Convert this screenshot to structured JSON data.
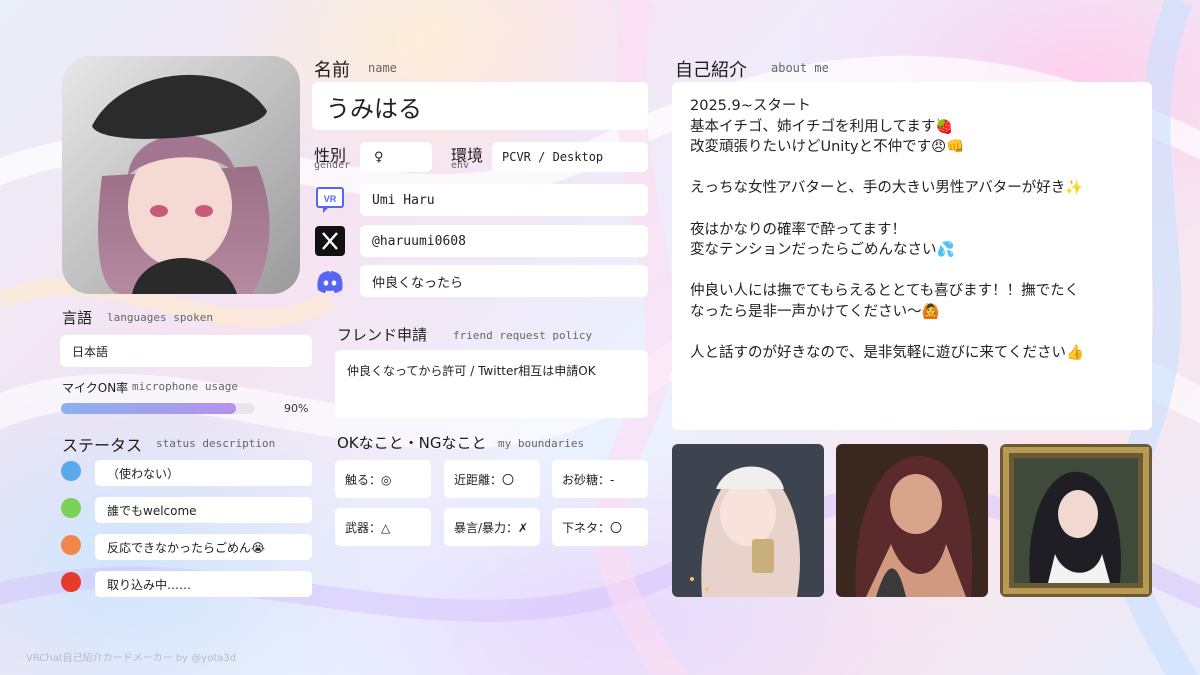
{
  "name": {
    "label": "名前",
    "label_en": "name",
    "value": "うみはる"
  },
  "gender": {
    "label": "性別",
    "label_en": "gender",
    "value": "♀"
  },
  "env": {
    "label": "環境",
    "label_en": "env",
    "value": "PCVR / Desktop"
  },
  "accounts": {
    "vrchat": {
      "icon": "vrchat-icon",
      "value": "Umi Haru"
    },
    "x": {
      "icon": "x-icon",
      "value": "@haruumi0608"
    },
    "discord": {
      "icon": "discord-icon",
      "value": "仲良くなったら"
    }
  },
  "languages": {
    "label": "言語",
    "label_en": "languages spoken",
    "value": "日本語"
  },
  "mic": {
    "label": "マイクON率",
    "label_en": "microphone usage",
    "percent": 90,
    "percent_text": "90%"
  },
  "status": {
    "label": "ステータス",
    "label_en": "status description",
    "items": [
      {
        "color": "#5aa9ec",
        "text": "（使わない）"
      },
      {
        "color": "#7ad25a",
        "text": "誰でもwelcome"
      },
      {
        "color": "#f0874a",
        "text": "反応できなかったらごめん😭"
      },
      {
        "color": "#e53a2e",
        "text": "取り込み中……"
      }
    ]
  },
  "friend": {
    "label": "フレンド申請",
    "label_en": "friend request policy",
    "value": "仲良くなってから許可 / Twitter相互は申請OK"
  },
  "boundaries": {
    "label": "OKなこと・NGなこと",
    "label_en": "my boundaries",
    "items": [
      "触る：◎",
      "近距離：〇",
      "お砂糖：-",
      "武器：△",
      "暴言/暴力：✗",
      "下ネタ：〇"
    ]
  },
  "about": {
    "label": "自己紹介",
    "label_en": "about me",
    "lines": [
      "2025.9~スタート",
      "基本イチゴ、姉イチゴを利用してます🍓",
      "改変頑張りたいけどUnityと不仲です😠👊",
      "",
      "えっちな女性アバターと、手の大きい男性アバターが好き✨",
      "",
      "夜はかなりの確率で酔ってます！",
      "変なテンションだったらごめんなさい💦",
      "",
      "仲良い人には撫でてもらえるととても喜びます！！撫でたく",
      "なったら是非一声かけてください〜🙆",
      "",
      "人と話すのが好きなので、是非気軽に遊びに来てください👍"
    ]
  },
  "footer": "VRChat自己紹介カードメーカー by @yota3d"
}
